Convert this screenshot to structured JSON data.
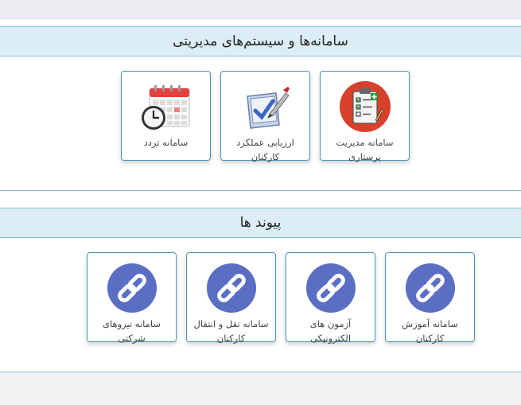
{
  "section1": {
    "title": "سامانه‌ها و سیستم‌های مدیریتی",
    "cards": [
      {
        "label": "سامانه مدیریت پرستاری",
        "icon": "clipboard-checklist-icon"
      },
      {
        "label": "ارزیابی عملکرد کارکنان",
        "icon": "checkbox-pen-icon"
      },
      {
        "label": "سامانه تردد",
        "icon": "calendar-clock-icon"
      }
    ]
  },
  "section2": {
    "title": "پیوند ها",
    "cards": [
      {
        "label": "سامانه آموزش کارکنان",
        "icon": "link-icon"
      },
      {
        "label": "آزمون های الکترونیکی",
        "icon": "link-icon"
      },
      {
        "label": "سامانه نقل و انتقال کارکنان",
        "icon": "link-icon"
      },
      {
        "label": "سامانه نیروهای شرکتی",
        "icon": "link-icon"
      }
    ]
  },
  "colors": {
    "header_bg": "#dcedf6",
    "border": "#89bfd6",
    "card_border": "#4a95b6",
    "link_circle": "#5a6fc4"
  }
}
